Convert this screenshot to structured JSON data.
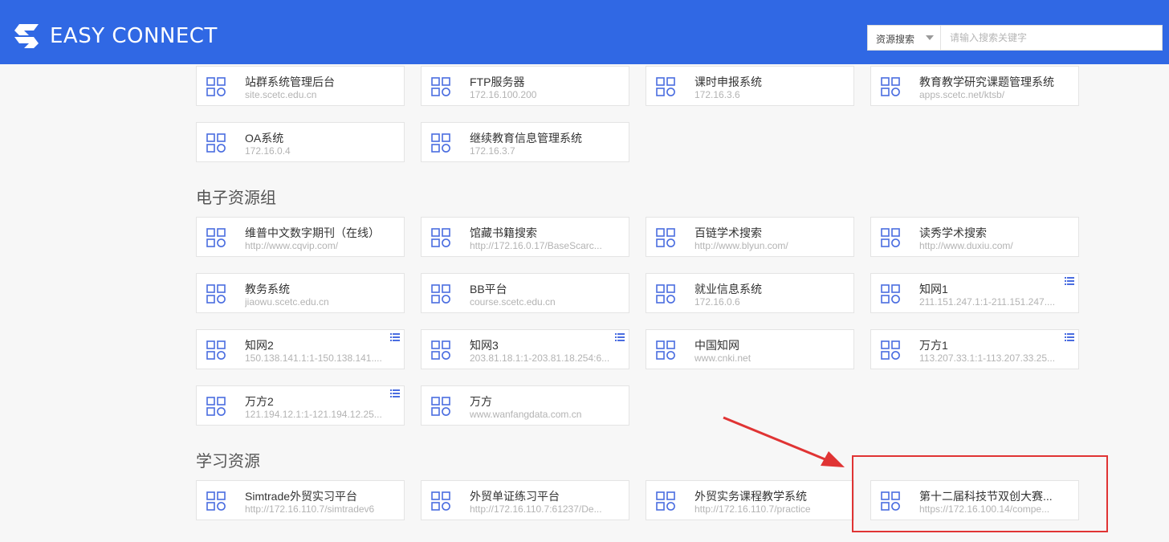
{
  "header": {
    "logo_text": "EASY CONNECT",
    "search": {
      "scope_label": "资源搜索",
      "placeholder": "请输入搜索关键字",
      "value": ""
    }
  },
  "colors": {
    "header_bg": "#3068e4",
    "icon_blue": "#4a6de0",
    "highlight_red": "#e03434"
  },
  "sections": [
    {
      "title": "",
      "items": [
        {
          "name": "站群系统管理后台",
          "url": "site.scetc.edu.cn",
          "menu": false
        },
        {
          "name": "FTP服务器",
          "url": "172.16.100.200",
          "menu": false
        },
        {
          "name": "课时申报系统",
          "url": "172.16.3.6",
          "menu": false
        },
        {
          "name": "教育教学研究课题管理系统",
          "url": "apps.scetc.net/ktsb/",
          "menu": false
        },
        {
          "name": "OA系统",
          "url": "172.16.0.4",
          "menu": false
        },
        {
          "name": "继续教育信息管理系统",
          "url": "172.16.3.7",
          "menu": false
        }
      ]
    },
    {
      "title": "电子资源组",
      "items": [
        {
          "name": "维普中文数字期刊（在线）",
          "url": "http://www.cqvip.com/",
          "menu": false
        },
        {
          "name": "馆藏书籍搜索",
          "url": "http://172.16.0.17/BaseScarc...",
          "menu": false
        },
        {
          "name": "百链学术搜索",
          "url": "http://www.blyun.com/",
          "menu": false
        },
        {
          "name": "读秀学术搜索",
          "url": "http://www.duxiu.com/",
          "menu": false
        },
        {
          "name": "教务系统",
          "url": "jiaowu.scetc.edu.cn",
          "menu": false
        },
        {
          "name": "BB平台",
          "url": "course.scetc.edu.cn",
          "menu": false
        },
        {
          "name": "就业信息系统",
          "url": "172.16.0.6",
          "menu": false
        },
        {
          "name": "知网1",
          "url": "211.151.247.1:1-211.151.247....",
          "menu": true
        },
        {
          "name": "知网2",
          "url": "150.138.141.1:1-150.138.141....",
          "menu": true
        },
        {
          "name": "知网3",
          "url": "203.81.18.1:1-203.81.18.254:6...",
          "menu": true
        },
        {
          "name": "中国知网",
          "url": "www.cnki.net",
          "menu": false
        },
        {
          "name": "万方1",
          "url": "113.207.33.1:1-113.207.33.25...",
          "menu": true
        },
        {
          "name": "万方2",
          "url": "121.194.12.1:1-121.194.12.25...",
          "menu": true
        },
        {
          "name": "万方",
          "url": "www.wanfangdata.com.cn",
          "menu": false
        }
      ]
    },
    {
      "title": "学习资源",
      "items": [
        {
          "name": "Simtrade外贸实习平台",
          "url": "http://172.16.110.7/simtradev6",
          "menu": false
        },
        {
          "name": "外贸单证练习平台",
          "url": "http://172.16.110.7:61237/De...",
          "menu": false
        },
        {
          "name": "外贸实务课程教学系统",
          "url": "http://172.16.110.7/practice",
          "menu": false
        },
        {
          "name": "第十二届科技节双创大赛...",
          "url": "https://172.16.100.14/compe...",
          "menu": false
        }
      ]
    }
  ]
}
